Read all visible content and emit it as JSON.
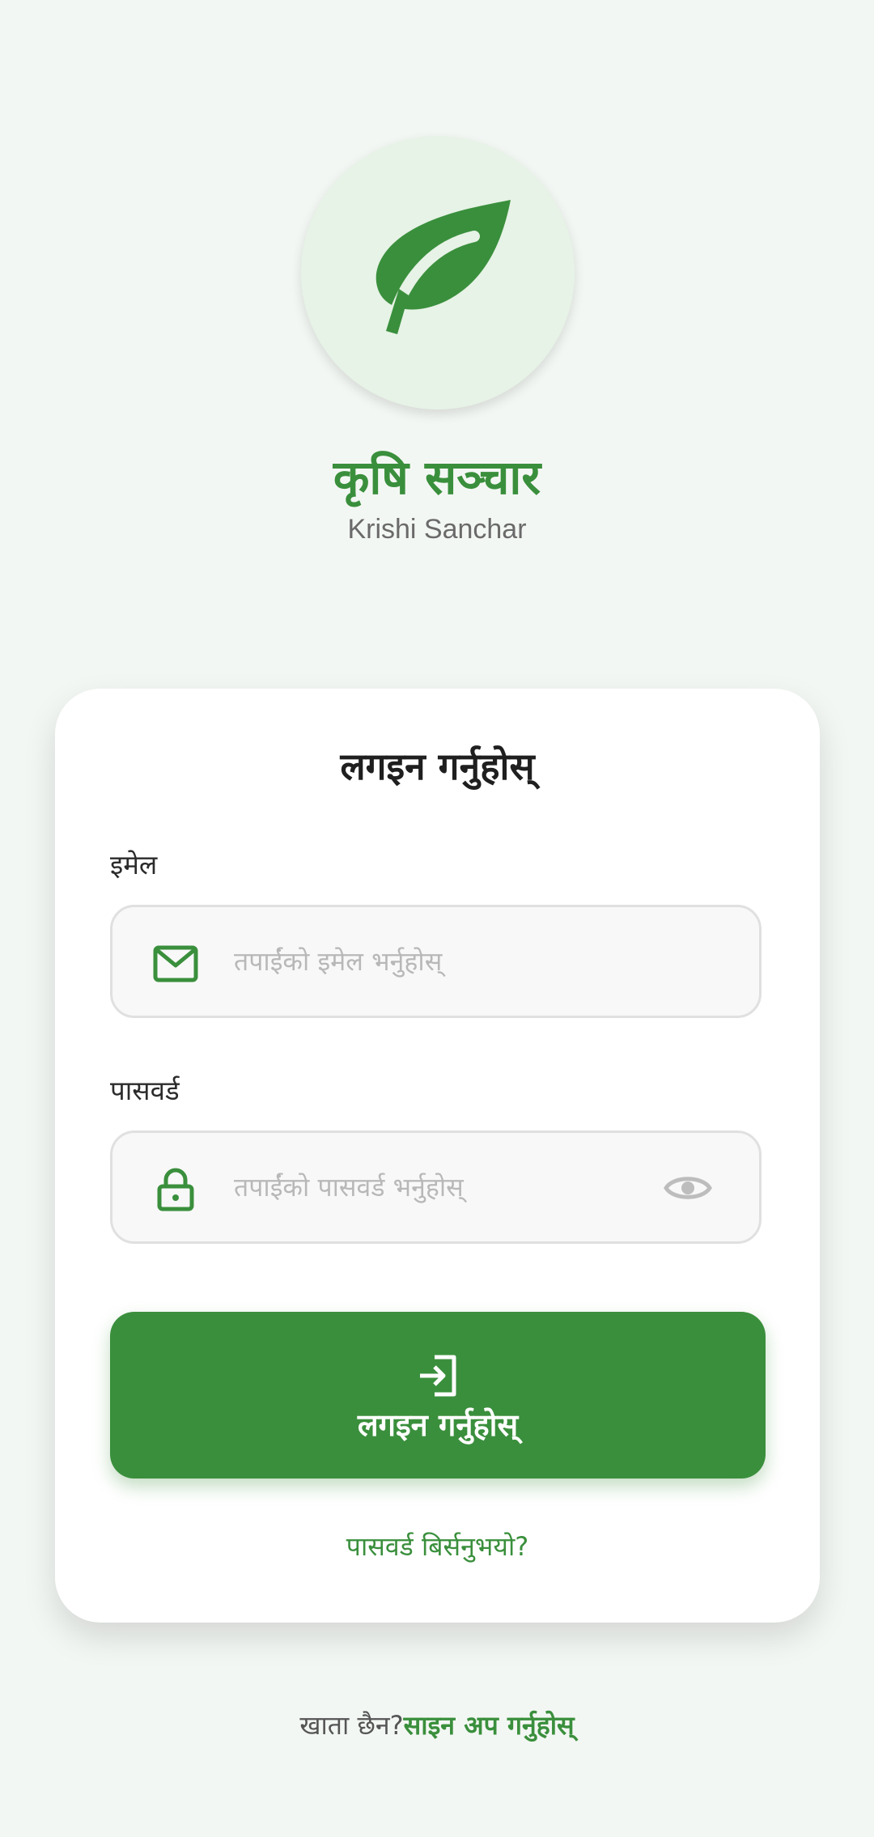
{
  "brand": {
    "title": "कृषि सञ्चार",
    "subtitle": "Krishi Sanchar",
    "logo_icon": "leaf-icon",
    "accent_color": "#3a8f3c"
  },
  "login_card": {
    "title": "लगइन गर्नुहोस्",
    "email": {
      "label": "इमेल",
      "placeholder": "तपाईंको इमेल भर्नुहोस्",
      "icon": "mail-icon"
    },
    "password": {
      "label": "पासवर्ड",
      "placeholder": "तपाईंको पासवर्ड भर्नुहोस्",
      "icon": "lock-icon",
      "toggle_icon": "eye-icon"
    },
    "submit": {
      "label": "लगइन गर्नुहोस्",
      "icon": "login-icon"
    },
    "forgot_password": "पासवर्ड बिर्सनुभयो?"
  },
  "footer": {
    "prompt": "खाता छैन?",
    "signup_link": "साइन अप गर्नुहोस्"
  }
}
